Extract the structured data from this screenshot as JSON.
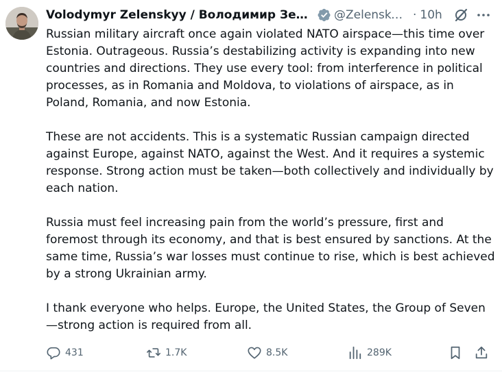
{
  "author": {
    "name": "Volodymyr Zelenskyy / Володимир Зеленський",
    "handle": "@ZelenskyyUa",
    "verified": true,
    "avatar_icon": "avatar-photo-icon"
  },
  "meta": {
    "separator": "·",
    "time": "10h"
  },
  "tweet": {
    "paragraphs": [
      "Russian military aircraft once again violated NATO airspace—this time over Estonia. Outrageous. Russia’s destabilizing activity is expanding into new countries and directions. They use every tool: from interference in political processes, as in Romania and Moldova, to violations of airspace, as in Poland, Romania, and now Estonia.",
      "These are not accidents. This is a systematic Russian campaign directed against Europe, against NATO, against the West. And it requires a systemic response. Strong action must be taken—both collectively and individually by each nation.",
      "Russia must feel increasing pain from the world’s pressure, first and foremost through its economy, and that is best ensured by sanctions. At the same time, Russia’s war losses must continue to rise, which is best achieved by a strong Ukrainian army.",
      "I thank everyone who helps. Europe, the United States, the Group of Seven —strong action is required from all."
    ]
  },
  "actions": {
    "replies": "431",
    "reposts": "1.7K",
    "likes": "8.5K",
    "views": "289K"
  },
  "colors": {
    "text": "#0f1419",
    "secondary": "#536471",
    "verified": "#829aab",
    "divider": "#eff3f4"
  }
}
